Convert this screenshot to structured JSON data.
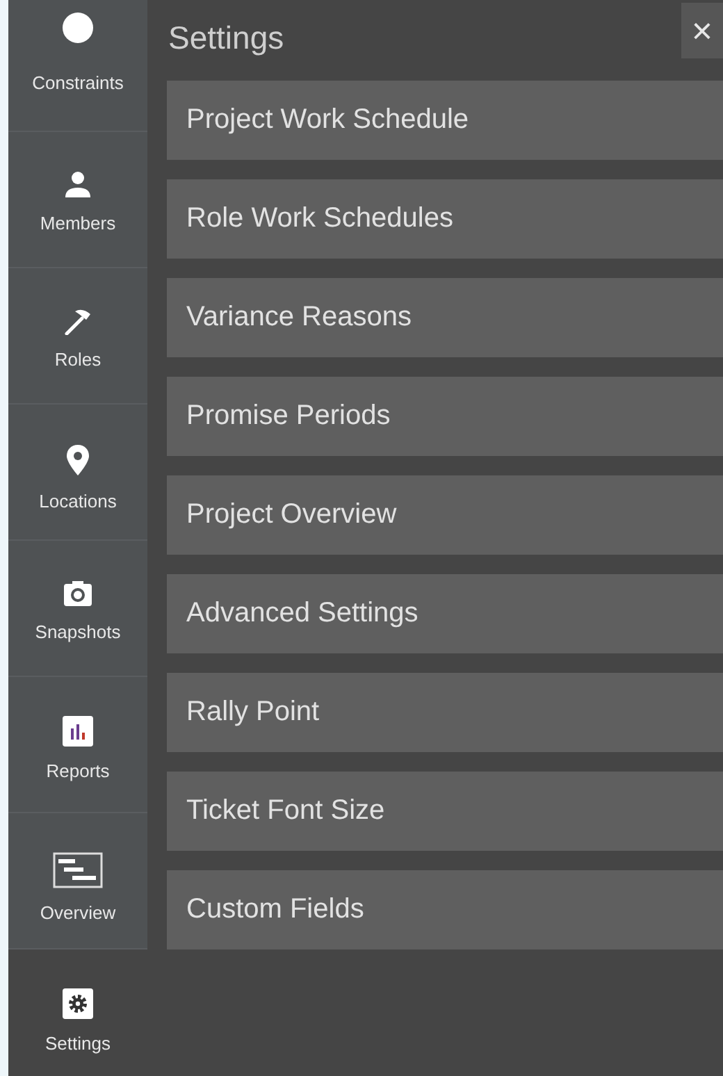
{
  "sidebar": {
    "items": [
      {
        "label": "Constraints",
        "selected": false
      },
      {
        "label": "Members",
        "selected": false
      },
      {
        "label": "Roles",
        "selected": false
      },
      {
        "label": "Locations",
        "selected": false
      },
      {
        "label": "Snapshots",
        "selected": false
      },
      {
        "label": "Reports",
        "selected": false
      },
      {
        "label": "Overview",
        "selected": false
      },
      {
        "label": "Settings",
        "selected": true
      }
    ]
  },
  "panel": {
    "title": "Settings",
    "close": "×",
    "items": [
      "Project Work Schedule",
      "Role Work Schedules",
      "Variance Reasons",
      "Promise Periods",
      "Project Overview",
      "Advanced Settings",
      "Rally Point",
      "Ticket Font Size",
      "Custom Fields"
    ]
  }
}
